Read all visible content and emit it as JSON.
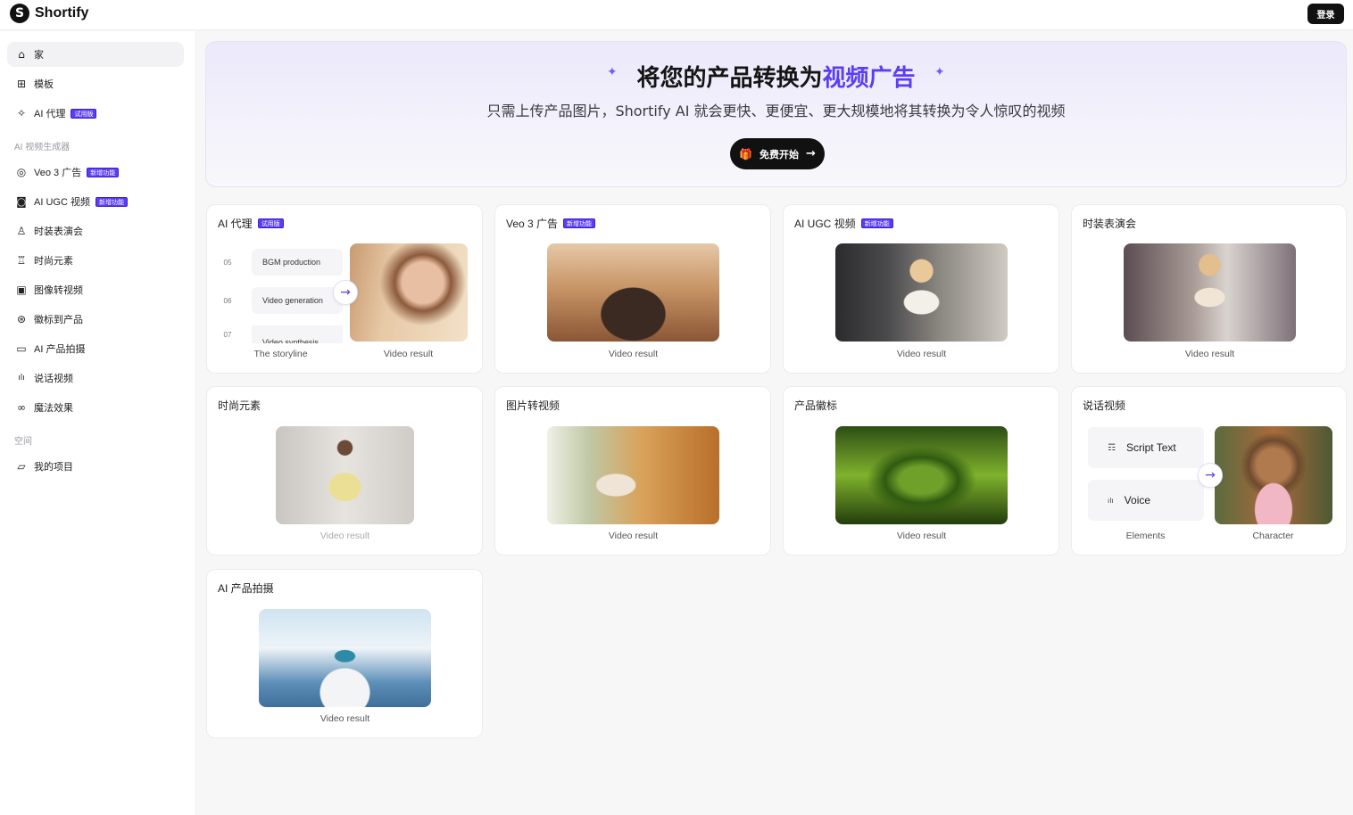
{
  "app": {
    "name": "Shortify",
    "logo_glyph": "S",
    "login_label": "登录"
  },
  "sidebar": {
    "items": [
      {
        "label": "家",
        "icon": "home-icon",
        "glyph": "⌂",
        "badge": ""
      },
      {
        "label": "模板",
        "icon": "template-icon",
        "glyph": "⊞",
        "badge": ""
      },
      {
        "label": "AI 代理",
        "icon": "sparkle-icon",
        "glyph": "✧",
        "badge": "试用版"
      },
      {
        "label": "Veo 3 广告",
        "icon": "veo-icon",
        "glyph": "◎",
        "badge": "新增功能"
      },
      {
        "label": "AI UGC 视频",
        "icon": "camera-icon",
        "glyph": "◙",
        "badge": "新增功能"
      },
      {
        "label": "时装表演会",
        "icon": "dress-icon",
        "glyph": "♙",
        "badge": ""
      },
      {
        "label": "时尚元素",
        "icon": "fashion-icon",
        "glyph": "♖",
        "badge": ""
      },
      {
        "label": "图像转视频",
        "icon": "image-video-icon",
        "glyph": "▣",
        "badge": ""
      },
      {
        "label": "徽标到产品",
        "icon": "logo-product-icon",
        "glyph": "⊛",
        "badge": ""
      },
      {
        "label": "AI 产品拍摄",
        "icon": "video-camera-icon",
        "glyph": "▭",
        "badge": ""
      },
      {
        "label": "说话视频",
        "icon": "waveform-icon",
        "glyph": "ılı",
        "badge": ""
      },
      {
        "label": "魔法效果",
        "icon": "magic-icon",
        "glyph": "∞",
        "badge": ""
      }
    ],
    "section_ai_video": "AI 视频生成器",
    "section_space": "空间",
    "my_projects": {
      "label": "我的项目",
      "icon": "folder-icon",
      "glyph": "▱"
    }
  },
  "hero": {
    "title_part1": "将您的产品转换为",
    "title_accent": "视频广告",
    "subtitle": "只需上传产品图片，Shortify AI 就会更快、更便宜、更大规模地将其转换为令人惊叹的视频",
    "cta_label": "免费开始",
    "cta_gift": "🎁",
    "cta_arrow": "→",
    "sparkle": "✦"
  },
  "cards": {
    "ai_agent": {
      "title": "AI 代理",
      "badge": "试用版",
      "steps": [
        {
          "num": "05",
          "label": "BGM production"
        },
        {
          "num": "06",
          "label": "Video generation"
        },
        {
          "num": "07",
          "label": "Video synthesis"
        }
      ],
      "left_caption": "The storyline",
      "right_caption": "Video result",
      "arrow": "→"
    },
    "veo3": {
      "title": "Veo 3 广告",
      "badge": "新增功能",
      "caption": "Video result"
    },
    "ugc": {
      "title": "AI UGC 视频",
      "badge": "新增功能",
      "caption": "Video result"
    },
    "fashion_show": {
      "title": "时装表演会",
      "caption": "Video result"
    },
    "fashion_elements": {
      "title": "时尚元素",
      "caption": "Video result"
    },
    "image_to_video": {
      "title": "图片转视频",
      "caption": "Video result"
    },
    "product_logo": {
      "title": "产品徽标",
      "caption": "Video result"
    },
    "talking_video": {
      "title": "说话视频",
      "script_label": "Script Text",
      "script_glyph": "☶",
      "voice_label": "Voice",
      "voice_glyph": "ılı",
      "left_caption": "Elements",
      "right_caption": "Character",
      "arrow": "→"
    },
    "product_shoot": {
      "title": "AI 产品拍摄",
      "caption": "Video result"
    }
  },
  "colors": {
    "accent": "#5b3df5",
    "dark": "#111111"
  }
}
